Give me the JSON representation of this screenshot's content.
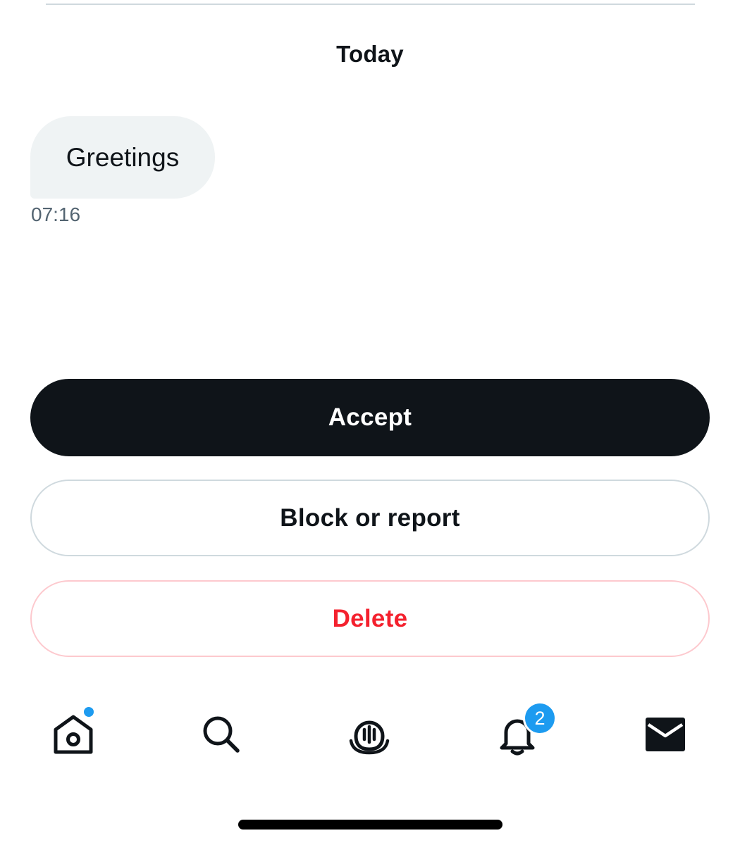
{
  "conversation": {
    "date_header": "Today",
    "messages": [
      {
        "text": "Greetings",
        "time": "07:16"
      }
    ]
  },
  "actions": {
    "accept_label": "Accept",
    "block_label": "Block or report",
    "delete_label": "Delete"
  },
  "tabbar": {
    "items": [
      {
        "icon": "home-icon",
        "has_dot": true
      },
      {
        "icon": "search-icon"
      },
      {
        "icon": "spaces-icon"
      },
      {
        "icon": "bell-icon",
        "badge": "2"
      },
      {
        "icon": "envelope-icon"
      }
    ]
  },
  "colors": {
    "accent": "#1d9bf0",
    "primary_button": "#0f1419",
    "danger": "#f4212e",
    "bubble": "#eff3f4",
    "muted_text": "#536471"
  }
}
